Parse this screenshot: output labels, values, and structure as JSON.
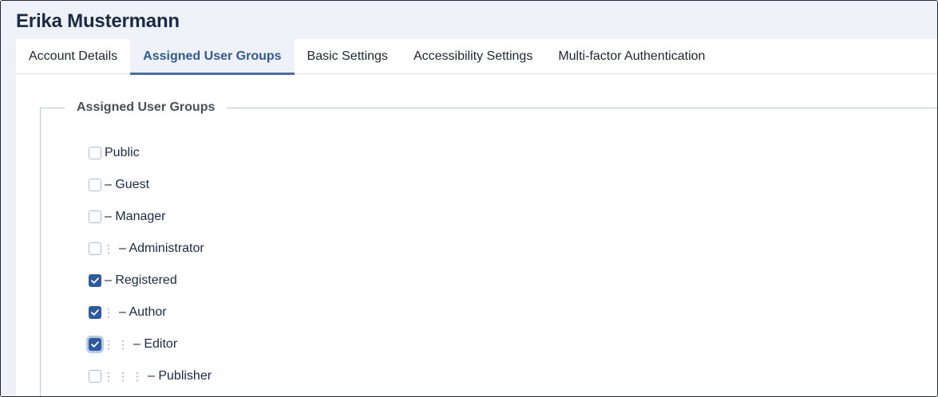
{
  "user": {
    "name": "Erika Mustermann"
  },
  "tabs": [
    {
      "label": "Account Details",
      "active": false
    },
    {
      "label": "Assigned User Groups",
      "active": true
    },
    {
      "label": "Basic Settings",
      "active": false
    },
    {
      "label": "Accessibility Settings",
      "active": false
    },
    {
      "label": "Multi-factor Authentication",
      "active": false
    }
  ],
  "groups_section": {
    "legend": "Assigned User Groups",
    "groups": [
      {
        "label": "Public",
        "checked": false,
        "level": 0
      },
      {
        "label": "– Guest",
        "checked": false,
        "level": 1
      },
      {
        "label": "– Manager",
        "checked": false,
        "level": 1
      },
      {
        "label": "– Administrator",
        "checked": false,
        "level": 2
      },
      {
        "label": "– Registered",
        "checked": true,
        "level": 1
      },
      {
        "label": "– Author",
        "checked": true,
        "level": 2
      },
      {
        "label": "– Editor",
        "checked": true,
        "level": 3,
        "focused": true
      },
      {
        "label": "– Publisher",
        "checked": false,
        "level": 4
      }
    ]
  },
  "colors": {
    "accent": "#2f5b9c",
    "active_tab_text": "#34598f",
    "header_bg": "#eef2f8"
  }
}
